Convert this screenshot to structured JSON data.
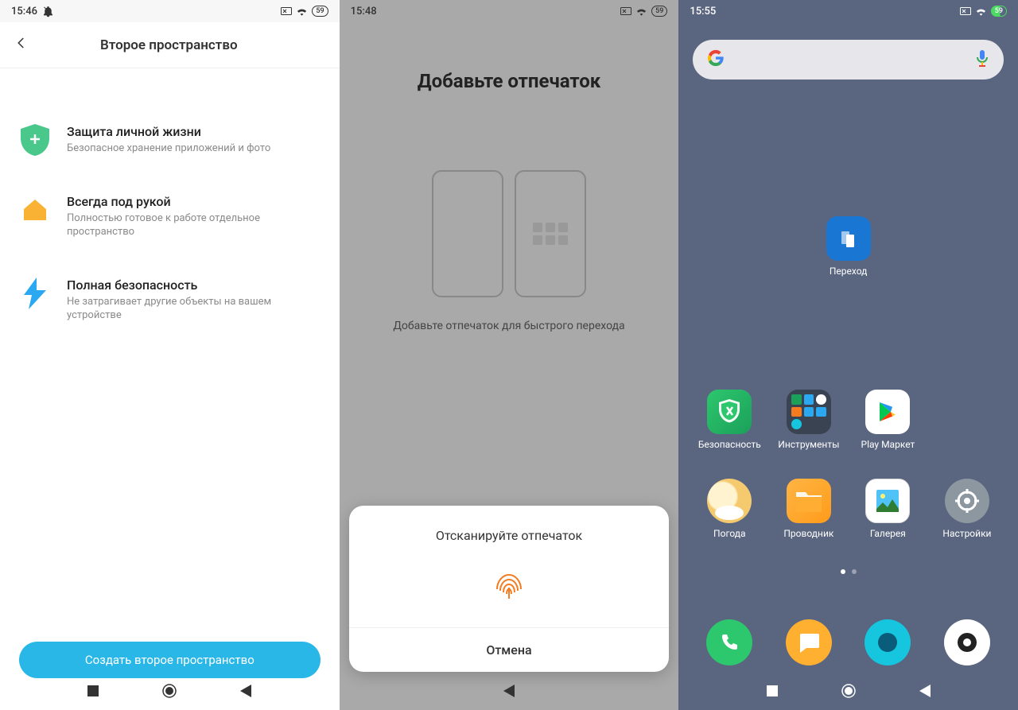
{
  "screen1": {
    "time": "15:46",
    "battery": "59",
    "header_title": "Второе пространство",
    "features": [
      {
        "title": "Защита личной жизни",
        "desc": "Безопасное хранение приложений и фото"
      },
      {
        "title": "Всегда под рукой",
        "desc": "Полностью готовое к работе отдельное пространство"
      },
      {
        "title": "Полная безопасность",
        "desc": "Не затрагивает другие объекты на вашем устройстве"
      }
    ],
    "button": "Создать второе пространство"
  },
  "screen2": {
    "time": "15:48",
    "battery": "59",
    "title": "Добавьте отпечаток",
    "subtitle": "Добавьте отпечаток для быстрого перехода",
    "sheet_title": "Отсканируйте отпечаток",
    "cancel": "Отмена"
  },
  "screen3": {
    "time": "15:55",
    "battery": "59",
    "apps": {
      "transfer": "Переход",
      "security": "Безопасность",
      "tools": "Инструменты",
      "play": "Play Маркет",
      "weather": "Погода",
      "files": "Проводник",
      "gallery": "Галерея",
      "settings": "Настройки"
    }
  }
}
